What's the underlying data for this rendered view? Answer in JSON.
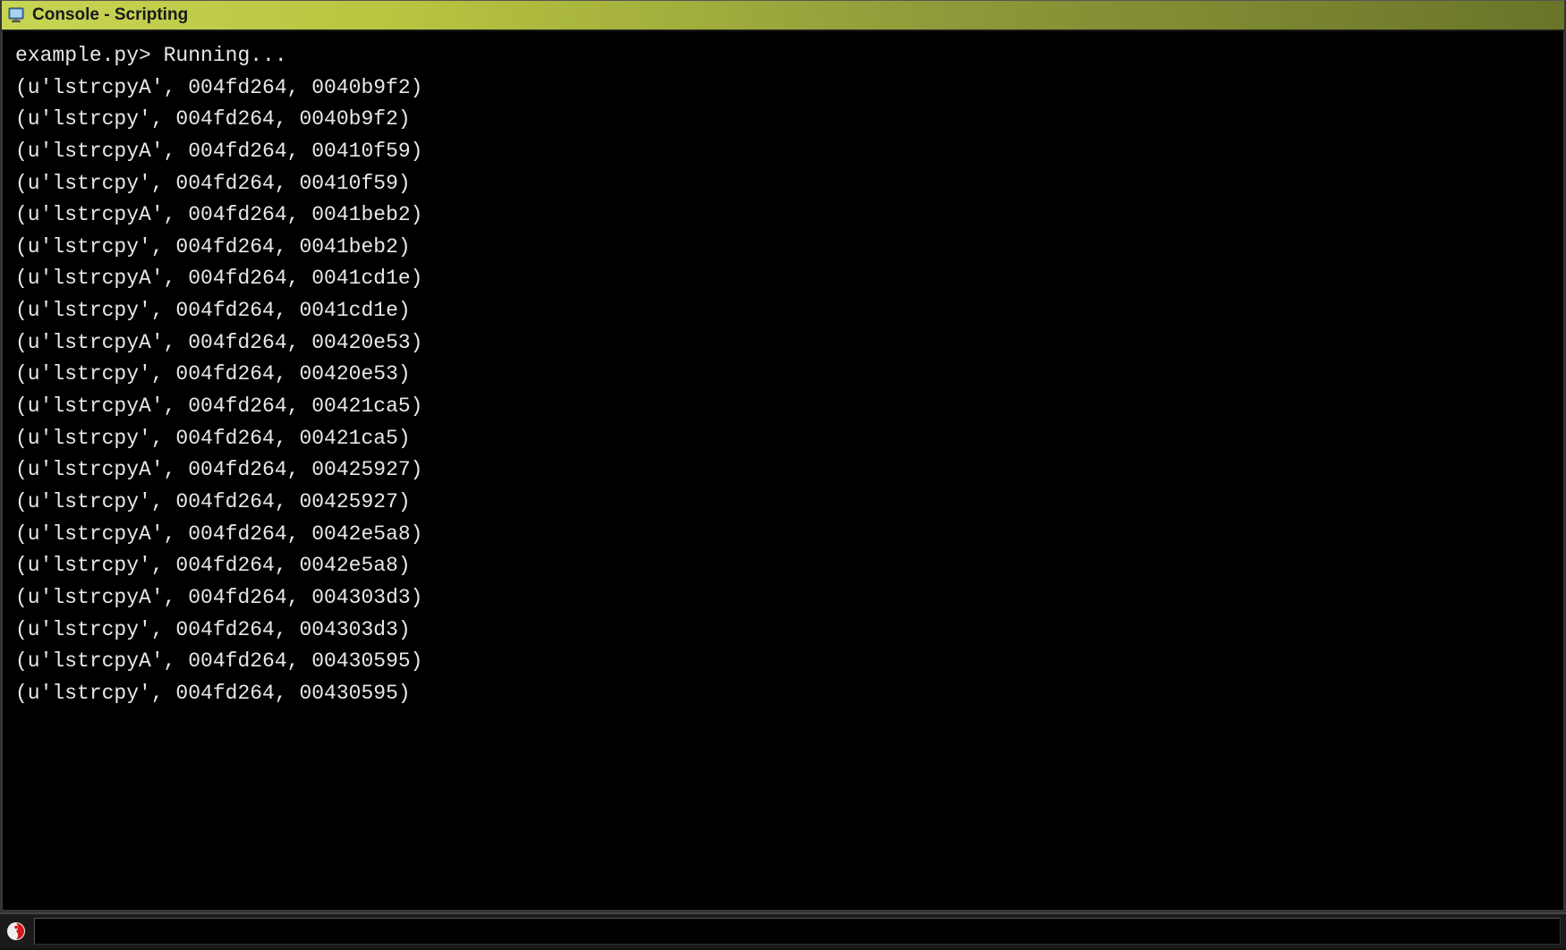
{
  "title_bar": {
    "title": "Console - Scripting"
  },
  "console": {
    "prompt_line": "example.py> Running...",
    "output_lines": [
      "(u'lstrcpyA', 004fd264, 0040b9f2)",
      "(u'lstrcpy', 004fd264, 0040b9f2)",
      "(u'lstrcpyA', 004fd264, 00410f59)",
      "(u'lstrcpy', 004fd264, 00410f59)",
      "(u'lstrcpyA', 004fd264, 0041beb2)",
      "(u'lstrcpy', 004fd264, 0041beb2)",
      "(u'lstrcpyA', 004fd264, 0041cd1e)",
      "(u'lstrcpy', 004fd264, 0041cd1e)",
      "(u'lstrcpyA', 004fd264, 00420e53)",
      "(u'lstrcpy', 004fd264, 00420e53)",
      "(u'lstrcpyA', 004fd264, 00421ca5)",
      "(u'lstrcpy', 004fd264, 00421ca5)",
      "(u'lstrcpyA', 004fd264, 00425927)",
      "(u'lstrcpy', 004fd264, 00425927)",
      "(u'lstrcpyA', 004fd264, 0042e5a8)",
      "(u'lstrcpy', 004fd264, 0042e5a8)",
      "(u'lstrcpyA', 004fd264, 004303d3)",
      "(u'lstrcpy', 004fd264, 004303d3)",
      "(u'lstrcpyA', 004fd264, 00430595)",
      "(u'lstrcpy', 004fd264, 00430595)"
    ]
  },
  "bottom_bar": {
    "input_value": ""
  }
}
